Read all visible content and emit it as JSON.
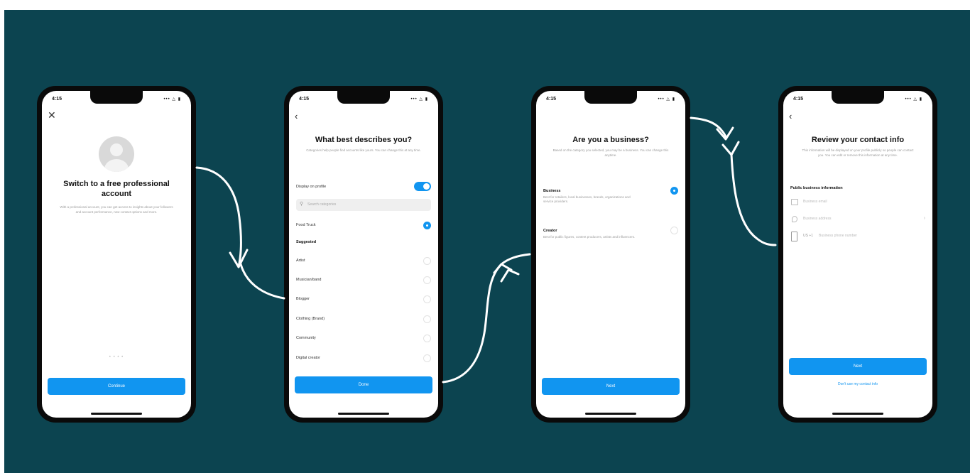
{
  "screens": [
    {
      "time": "4:15",
      "status_icons": "••• △ ▮",
      "close_icon": "✕",
      "title": "Switch to a free professional account",
      "subtitle": "With a professional account, you can get access to insights about your followers and account performance, new contact options and more.",
      "page_dots": "• • • •",
      "button_label": "Continue"
    },
    {
      "time": "4:15",
      "status_icons": "••• △ ▮",
      "back_icon": "‹",
      "title": "What best describes you?",
      "subtitle": "Categories help people find accounts like yours. You can change this at any time.",
      "display_label": "Display on profile",
      "search_placeholder": "Search categories",
      "selected": "Food Truck",
      "suggested_heading": "Suggested",
      "categories": [
        "Artist",
        "Musician/band",
        "Blogger",
        "Clothing (Brand)",
        "Community",
        "Digital creator"
      ],
      "button_label": "Done"
    },
    {
      "time": "4:15",
      "status_icons": "••• △ ▮",
      "title": "Are you a business?",
      "subtitle": "Based on the category you selected, you may be a business. You can change this anytime.",
      "options": [
        {
          "label": "Business",
          "desc": "Best for retailers, local businesses, brands, organizations and service providers."
        },
        {
          "label": "Creator",
          "desc": "Best for public figures, content producers, artists and influencers."
        }
      ],
      "button_label": "Next"
    },
    {
      "time": "4:15",
      "status_icons": "••• △ ▮",
      "back_icon": "‹",
      "title": "Review your contact info",
      "subtitle": "This information will be displayed on your profile publicly so people can contact you. You can edit or remove this information at any time.",
      "section_label": "Public business information",
      "fields": [
        "Business email",
        "Business address",
        "Business phone number"
      ],
      "country_code": "US +1",
      "button_label": "Next",
      "link_label": "Don't use my contact info"
    }
  ],
  "colors": {
    "background": "#0c4450",
    "accent": "#1195f0",
    "arrow": "#ffffff"
  }
}
